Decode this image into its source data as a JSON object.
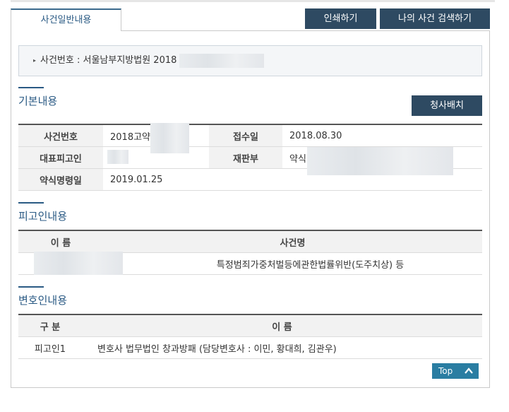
{
  "tabs": {
    "active_label": "사건일반내용"
  },
  "toolbar": {
    "print_label": "인쇄하기",
    "search_label": "나의 사건 검색하기"
  },
  "case_header": {
    "text": "사건번호 : 서울남부지방법원 2018"
  },
  "basic": {
    "title": "기본내용",
    "office_button": "청사배치",
    "rows": [
      {
        "label1": "사건번호",
        "value1": "2018고약",
        "label2": "접수일",
        "value2": "2018.08.30"
      },
      {
        "label1": "대표피고인",
        "value1": "",
        "label2": "재판부",
        "value2": "약식"
      },
      {
        "label1": "약식명령일",
        "value1": "2019.01.25"
      }
    ]
  },
  "defendant": {
    "title": "피고인내용",
    "headers": [
      "이 름",
      "사건명"
    ],
    "rows": [
      {
        "name": "",
        "case_name": "특정범죄가중처벌등에관한법률위반(도주치상) 등"
      }
    ]
  },
  "lawyer": {
    "title": "변호인내용",
    "headers": [
      "구 분",
      "이 름"
    ],
    "rows": [
      {
        "type": "피고인1",
        "name": "변호사 법무법인 창과방패 (담당변호사 : 이민, 황대희, 김관우)"
      }
    ]
  },
  "top_button": {
    "label": "Top"
  },
  "colors": {
    "primary_blue": "#2a5a84",
    "dark_button": "#2e4a62",
    "top_button": "#2a7da2"
  }
}
